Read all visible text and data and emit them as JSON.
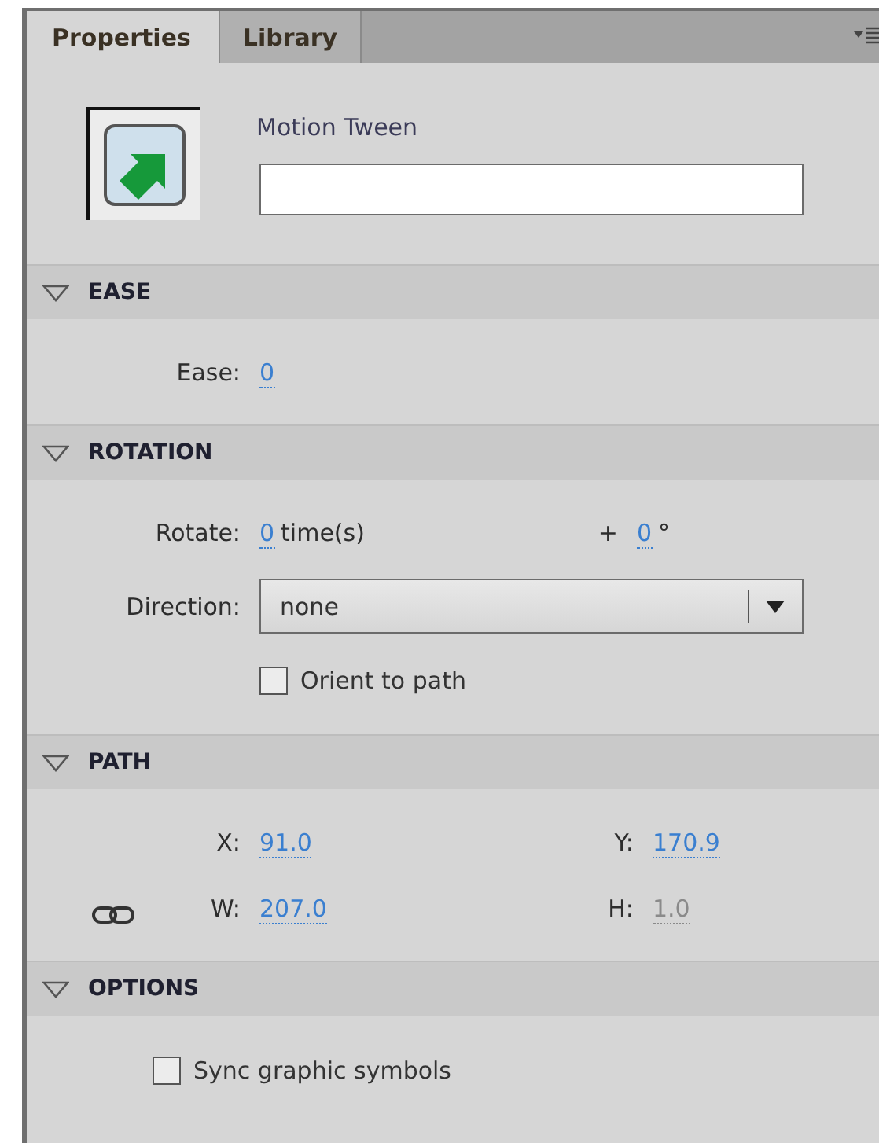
{
  "tabs": [
    {
      "label": "Properties",
      "selected": true
    },
    {
      "label": "Library",
      "selected": false
    }
  ],
  "header": {
    "type_label": "Motion Tween"
  },
  "sections": [
    {
      "title": "EASE",
      "expanded": true,
      "rows": [
        {
          "kind": "values",
          "items": [
            {
              "label": "Ease:",
              "value": "0",
              "disabled": false
            }
          ]
        }
      ]
    },
    {
      "title": "ROTATION",
      "expanded": true,
      "rows": [
        {
          "kind": "values",
          "items": [
            {
              "label": "Rotate:",
              "value": "0",
              "unit": "time(s)",
              "disabled": false
            },
            {
              "label": "+",
              "value": "0",
              "unit": "°",
              "disabled": false
            }
          ]
        },
        {
          "kind": "dropdown",
          "label": "Direction:",
          "value": "none"
        },
        {
          "kind": "checkbox",
          "label": "Orient to path",
          "checked": false
        }
      ]
    },
    {
      "title": "PATH",
      "expanded": true,
      "rows": [
        {
          "kind": "values",
          "items": [
            {
              "label": "X:",
              "value": "91.0",
              "disabled": false
            },
            {
              "label": "Y:",
              "value": "170.9",
              "disabled": false
            }
          ]
        },
        {
          "kind": "values",
          "constrained": true,
          "items": [
            {
              "label": "W:",
              "value": "207.0",
              "disabled": false
            },
            {
              "label": "H:",
              "value": "1.0",
              "disabled": true
            }
          ]
        }
      ]
    },
    {
      "title": "OPTIONS",
      "expanded": true,
      "rows": [
        {
          "kind": "checkbox",
          "label": "Sync graphic symbols",
          "checked": false,
          "indent": true
        }
      ]
    }
  ]
}
